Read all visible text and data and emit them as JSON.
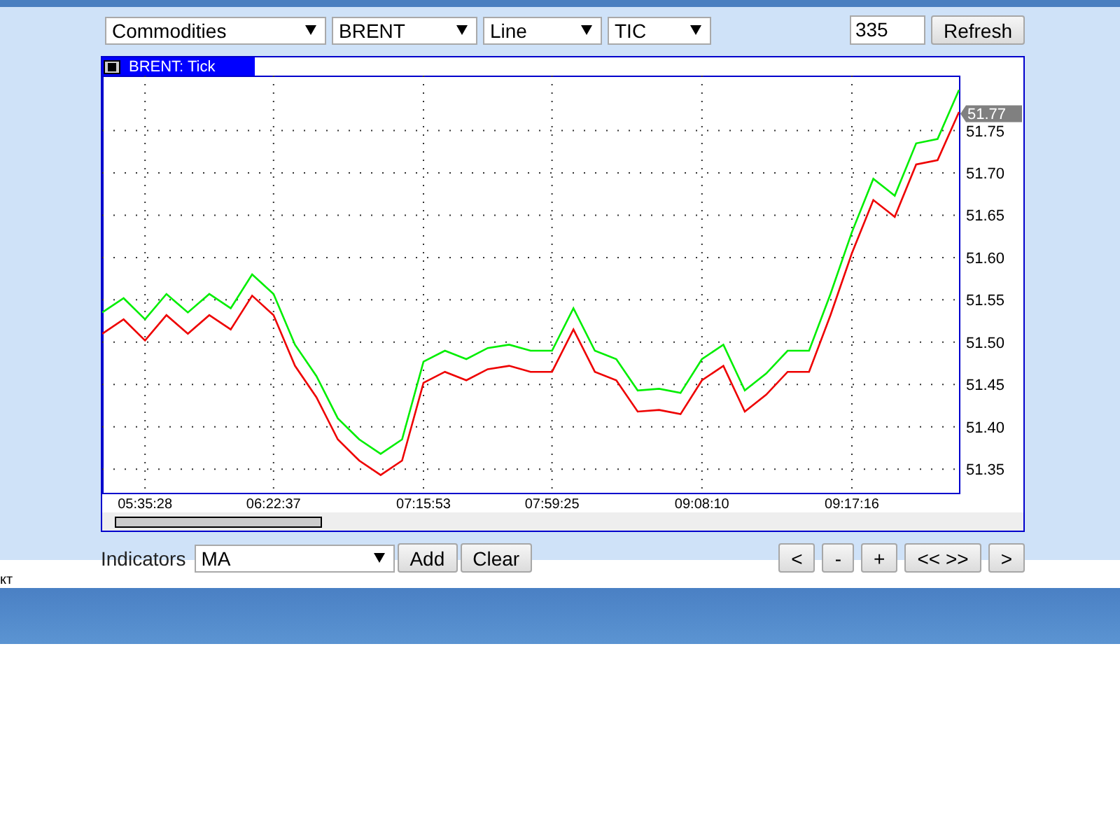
{
  "toolbar": {
    "selects": [
      {
        "value": "Commodities"
      },
      {
        "value": "BRENT"
      },
      {
        "value": "Line"
      },
      {
        "value": "TIC"
      }
    ],
    "count_field": {
      "value": "335"
    },
    "refresh_button": "Refresh"
  },
  "chart_panel": {
    "tab_label": "BRENT: Tick",
    "current_price": "51.77",
    "chart_data": {
      "type": "line",
      "grid": true,
      "ylim": [
        51.322,
        51.815
      ],
      "categories": [
        null,
        null,
        "05:35:28",
        null,
        null,
        null,
        null,
        null,
        "06:22:37",
        null,
        null,
        null,
        null,
        null,
        null,
        "07:15:53",
        null,
        null,
        null,
        null,
        null,
        "07:59:25",
        null,
        null,
        null,
        null,
        null,
        null,
        "09:08:10",
        null,
        null,
        null,
        null,
        null,
        null,
        "09:17:16",
        null,
        null,
        null,
        null,
        null
      ],
      "yticks": [
        {
          "value": 51.35,
          "label": "51.35"
        },
        {
          "value": 51.4,
          "label": "51.40"
        },
        {
          "value": 51.45,
          "label": "51.45"
        },
        {
          "value": 51.5,
          "label": "51.50"
        },
        {
          "value": 51.55,
          "label": "51.55"
        },
        {
          "value": 51.6,
          "label": "51.60"
        },
        {
          "value": 51.65,
          "label": "51.65"
        },
        {
          "value": 51.7,
          "label": "51.70"
        },
        {
          "value": 51.75,
          "label": "51.75"
        }
      ],
      "series": [
        {
          "color": "#00ee00",
          "values": [
            51.535,
            51.552,
            51.527,
            51.557,
            51.535,
            51.557,
            51.54,
            51.58,
            51.557,
            51.497,
            51.46,
            51.41,
            51.385,
            51.368,
            51.385,
            51.477,
            51.49,
            51.48,
            51.493,
            51.497,
            51.49,
            51.49,
            51.54,
            51.49,
            51.48,
            51.443,
            51.445,
            51.44,
            51.48,
            51.497,
            51.443,
            51.463,
            51.49,
            51.49,
            51.557,
            51.63,
            51.693,
            51.673,
            51.735,
            51.74,
            51.798
          ]
        },
        {
          "color": "#ee0000",
          "values": [
            51.51,
            51.527,
            51.502,
            51.532,
            51.51,
            51.532,
            51.515,
            51.555,
            51.532,
            51.472,
            51.435,
            51.385,
            51.36,
            51.343,
            51.36,
            51.452,
            51.465,
            51.455,
            51.468,
            51.472,
            51.465,
            51.465,
            51.515,
            51.465,
            51.455,
            51.418,
            51.42,
            51.415,
            51.455,
            51.472,
            51.418,
            51.438,
            51.465,
            51.465,
            51.532,
            51.605,
            51.668,
            51.648,
            51.71,
            51.715,
            51.772
          ]
        }
      ]
    }
  },
  "bottom_bar": {
    "indicators_label": "Indicators",
    "indicator_select": {
      "value": "MA"
    },
    "buttons": [
      "Add",
      "Clear"
    ],
    "nav_buttons": [
      "<",
      "-",
      "+",
      "<< >>",
      ">"
    ]
  },
  "footer_text": "кт"
}
